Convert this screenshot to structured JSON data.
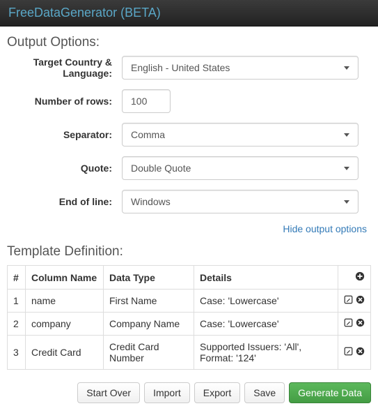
{
  "app_title": "FreeDataGenerator (BETA)",
  "sections": {
    "output_options": "Output Options:",
    "template_definition": "Template Definition:"
  },
  "form": {
    "target_label": "Target Country & Language:",
    "target_value": "English - United States",
    "rows_label": "Number of rows:",
    "rows_value": "100",
    "separator_label": "Separator:",
    "separator_value": "Comma",
    "quote_label": "Quote:",
    "quote_value": "Double Quote",
    "eol_label": "End of line:",
    "eol_value": "Windows"
  },
  "links": {
    "hide_output": "Hide output options"
  },
  "table": {
    "headers": {
      "hash": "#",
      "name": "Column Name",
      "type": "Data Type",
      "details": "Details"
    },
    "rows": [
      {
        "n": "1",
        "name": "name",
        "type": "First Name",
        "details": "Case: 'Lowercase'"
      },
      {
        "n": "2",
        "name": "company",
        "type": "Company Name",
        "details": "Case: 'Lowercase'"
      },
      {
        "n": "3",
        "name": "Credit Card",
        "type": "Credit Card Number",
        "details": "Supported Issuers: 'All', Format: '124'"
      }
    ]
  },
  "buttons": {
    "start_over": "Start Over",
    "import": "Import",
    "export": "Export",
    "save": "Save",
    "generate": "Generate Data"
  }
}
